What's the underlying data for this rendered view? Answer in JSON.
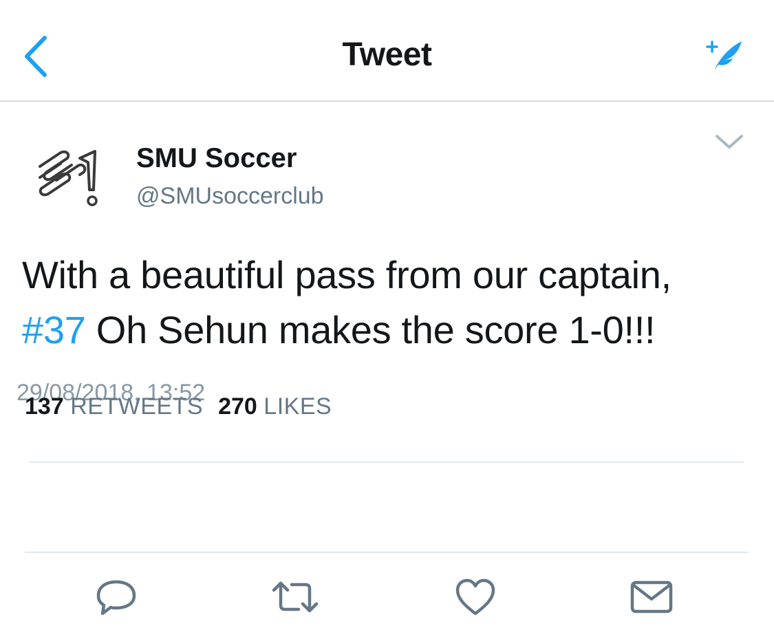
{
  "header": {
    "title": "Tweet",
    "back_icon": "chevron-left-icon",
    "compose_icon": "compose-feather-icon",
    "accent_color": "#1da1f2"
  },
  "tweet": {
    "author_name": "SMU Soccer",
    "author_handle": "@SMUsoccerclub",
    "avatar_icon": "sm-logo-icon",
    "text_line1": "With a beautiful pass from our captain,",
    "hashtag": "#37",
    "text_rest": " Oh Sehun makes the score 1-0!!!",
    "timestamp": "29/08/2018, 13:52",
    "menu_icon": "chevron-down-icon"
  },
  "stats": {
    "retweets_count": "137",
    "retweets_label": "RETWEETS",
    "likes_count": "270",
    "likes_label": "LIKES"
  },
  "actions": [
    {
      "icon": "reply-icon"
    },
    {
      "icon": "retweet-icon"
    },
    {
      "icon": "like-icon"
    },
    {
      "icon": "message-icon"
    }
  ]
}
